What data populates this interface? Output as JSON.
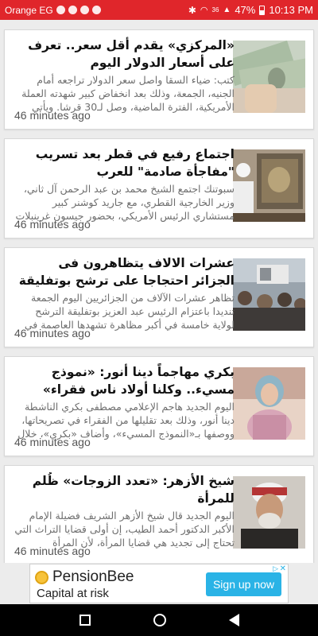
{
  "status_bar": {
    "carrier": "Orange EG",
    "signal": "36",
    "battery": "47%",
    "time": "10:13 PM"
  },
  "articles": [
    {
      "headline": "«المركزي» يقدم أقل سعر.. تعرف على أسعار الدولار اليوم",
      "summary": "كتب: ضياء السقا واصل سعر الدولار تراجعه أمام الجنيه، الجمعة، وذلك بعد انخفاض كبير شهدته العملة الأمريكية، الفترة الماضية، وصل لـ30 قرشا. ويأتي",
      "time": "46 minutes ago",
      "image": "dollar-banknotes"
    },
    {
      "headline": "اجتماع رفيع في قطر بعد تسريب \"مفاجأة صادمة\" للعرب",
      "summary": "سبوتنك اجتمع الشيخ محمد بن عبد الرحمن آل ثاني، وزير الخارجية القطري، مع جاريد كوشنر كبير مستشاري الرئيس الأمريكي، بحضور جيسون غرينبلات",
      "time": "46 minutes ago",
      "image": "meeting-officials"
    },
    {
      "headline": "عشرات الالاف يتظاهرون فى الجزائر احتجاجا على ترشح بوتفليقة لولاية خامسة",
      "summary": "تظاهر عشرات الآلاف من الجزائريين اليوم الجمعة تنديدا باعتزام الرئيس عبد العزيز بوتفليقة الترشح لولاية خامسة في أكبر مظاهرة تشهدها العاصمة في",
      "time": "46 minutes ago",
      "image": "protest-crowd"
    },
    {
      "headline": "بكري مهاجماً دينا أنور: «نموذج مسيء.. وكلنا أولاد ناس فقراء»",
      "summary": "اليوم الجديد هاجم الإعلامي مصطفى بكري الناشطة دينا أنور، وذلك بعد تقليلها من الفقراء في تصريحاتها، ووصفها بـ«النموذج المسيء»، وأضاف «بكري»، خلال",
      "time": "46 minutes ago",
      "image": "woman-portrait"
    },
    {
      "headline": "شيخ الأزهر: «تعدد الزوجات» ظُلم للمرأة",
      "summary": "اليوم الجديد قال شيخ الأزهر الشريف فضيلة الإمام الأكبر الدكتور أحمد الطيب، إن أولى قضايا التراث التي تحتاج إلى تجديد هي قضايا المرأة، لأن المرأة",
      "time": "46 minutes ago",
      "image": "sheikh-portrait"
    }
  ],
  "ad": {
    "brand": "PensionBee",
    "tagline": "Capital at risk",
    "cta": "Sign up now"
  }
}
